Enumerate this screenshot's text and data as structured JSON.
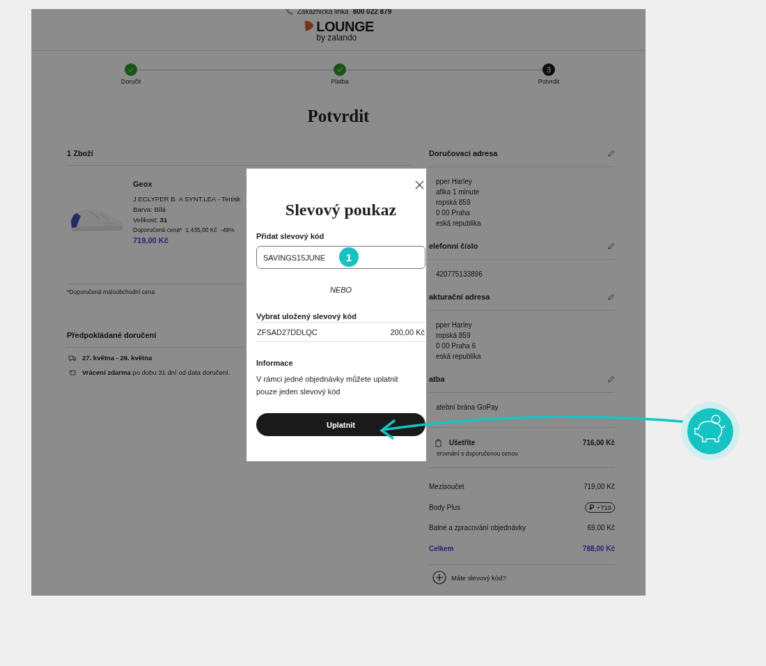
{
  "header": {
    "hotline_label": "Zákaznická linka",
    "hotline_number": "800 022 879",
    "logo_name": "LOUNGE",
    "logo_sub": "by zalando"
  },
  "steps": [
    {
      "label": "Doručit",
      "done": true
    },
    {
      "label": "Platba",
      "done": true
    },
    {
      "label": "Potvrdit",
      "done": false,
      "number": "3"
    }
  ],
  "title": "Potvrdit",
  "order": {
    "heading": "1 Zboží",
    "item": {
      "brand": "Geox",
      "name": "J ECLYPER B. A SYNT.LEA - Tenisk",
      "color_line": "Barva: Bílá",
      "size": "Velikost: **31**",
      "rrp_label": "Doporučená cena*",
      "rrp": "1 435,00 Kč",
      "discount": "-49%",
      "price": "719,00 Kč"
    },
    "footnote": "*Doporučená maloobchodní cena"
  },
  "delivery": {
    "heading": "Předpokládané doručení",
    "lines": [
      {
        "kind": "truck",
        "text": "**27. května - 29. května**"
      },
      {
        "kind": "return",
        "text": "**Vrácení zdarma** po dobu 31 dní od data doručení."
      }
    ]
  },
  "sections": [
    {
      "heading": "Doručovací adresa",
      "lines": [
        "pper Harley",
        "afika 1 minute",
        "ropská 859",
        "0 00 Praha",
        "eská republika"
      ]
    },
    {
      "heading": "elefonní číslo",
      "lines": [
        "420775133896"
      ]
    },
    {
      "heading": "akturační adresa",
      "lines": [
        "pper Harley",
        "ropská 859",
        "0 00 Praha 6",
        "eská republika"
      ]
    },
    {
      "heading": "atba",
      "lines": [
        "atební brána GoPay"
      ]
    }
  ],
  "savings": {
    "label": "Ušetříte",
    "amount": "716,00 Kč",
    "note": "srovnání s doporučenou cenou"
  },
  "totals": [
    {
      "kind": "plain",
      "label": "Mezisoučet",
      "value": "719,00 Kč"
    },
    {
      "kind": "points",
      "label": "Body Plus",
      "value": "+719"
    },
    {
      "kind": "plain",
      "label": "Balné a zpracování objednávky",
      "value": "69,00 Kč"
    },
    {
      "kind": "total",
      "label": "Celkem",
      "value": "788,00 Kč"
    }
  ],
  "promo_link": "Máte slevový kód?",
  "modal": {
    "title": "Slevový poukaz",
    "code_label": "Přidat slevový kód",
    "code_value": "SAVINGS15JUNE",
    "or": "NEBO",
    "saved_label": "Vybrat uložený slevový kód",
    "saved": [
      {
        "code": "ZFSAD27DDLQC",
        "amount": "200,00 Kč"
      }
    ],
    "info_heading": "Informace",
    "info_text": "V rámci jedné objednávky můžete uplatnit pouze jeden slevový kód",
    "apply": "Uplatnit"
  },
  "annotation": {
    "step": "1"
  }
}
